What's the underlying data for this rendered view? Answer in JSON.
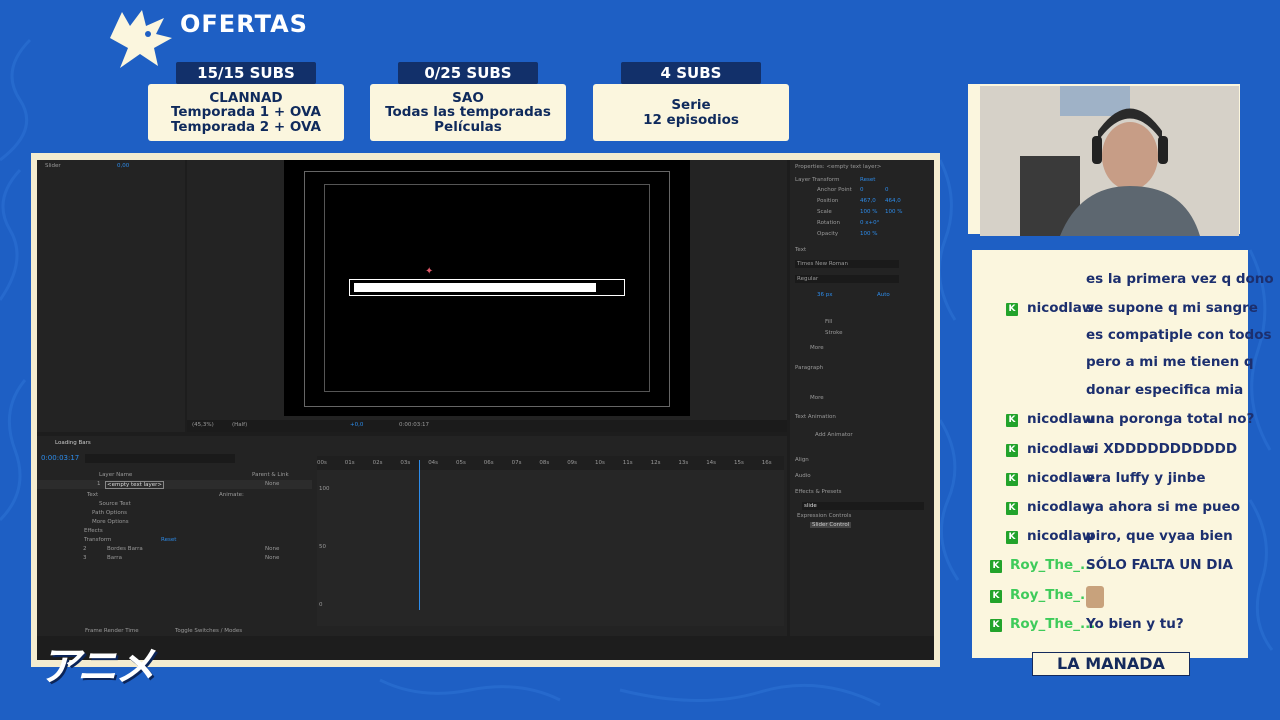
{
  "overlay": {
    "header_title": "OFERTAS",
    "offers": [
      {
        "tag": "15/15 SUBS",
        "lines": [
          "CLANNAD",
          "Temporada 1 + OVA",
          "Temporada 2 + OVA"
        ]
      },
      {
        "tag": "0/25 SUBS",
        "lines": [
          "SAO",
          "Todas las temporadas",
          "Películas"
        ]
      },
      {
        "tag": "4 SUBS",
        "lines": [
          "Serie",
          "12 episodios"
        ]
      }
    ],
    "footer_label": "LA MANADA",
    "anime_logo": "アニメ",
    "colors": {
      "background": "#1e5fc4",
      "card": "#fbf6de",
      "tag": "#12306a",
      "chat_text": "#1c2f6e",
      "badge": "#22a32b"
    }
  },
  "after_effects": {
    "effect_controls": {
      "effect": "Slider",
      "value": "0,00"
    },
    "viewer": {
      "zoom": "(45,3%)",
      "resolution": "(Half)",
      "exposure": "+0,0",
      "timecode": "0:00:03:17"
    },
    "timeline": {
      "comp_name": "Loading Bars",
      "timecode": "0:00:03:17",
      "search_placeholder": "",
      "columns": {
        "layer_name": "Layer Name",
        "parent": "Parent & Link"
      },
      "ruler": [
        "00s",
        "01s",
        "02s",
        "03s",
        "04s",
        "05s",
        "06s",
        "07s",
        "08s",
        "09s",
        "10s",
        "11s",
        "12s",
        "13s",
        "14s",
        "15s",
        "16s"
      ],
      "graph_values": [
        "100",
        "50",
        "0"
      ],
      "layers": [
        {
          "num": "1",
          "name": "<empty text layer>",
          "parent": "None",
          "color": "#d9534f"
        },
        {
          "num": "2",
          "name": "Bordes Barra",
          "parent": "None",
          "color": "#8a6fd1"
        },
        {
          "num": "3",
          "name": "Barra",
          "parent": "None",
          "color": "#8a6fd1"
        }
      ],
      "sub_rows": [
        "Text",
        "Source Text",
        "Path Options",
        "More Options",
        "Effects",
        "Transform"
      ],
      "animate_label": "Animate:",
      "reset_label": "Reset",
      "footer_left": "Frame Render Time",
      "footer_mid": "Toggle Switches / Modes"
    },
    "properties": {
      "title": "Properties: <empty text layer>",
      "layer_transform": "Layer Transform",
      "reset": "Reset",
      "rows": [
        {
          "label": "Anchor Point",
          "v1": "0",
          "v2": "0"
        },
        {
          "label": "Position",
          "v1": "467,0",
          "v2": "464,0"
        },
        {
          "label": "Scale",
          "v1": "100 %",
          "v2": "100 %"
        },
        {
          "label": "Rotation",
          "v1": "0 x+0°",
          "v2": ""
        },
        {
          "label": "Opacity",
          "v1": "100 %",
          "v2": ""
        }
      ],
      "text_section": "Text",
      "font": "Times New Roman",
      "style": "Regular",
      "size": "36 px",
      "leading": "Auto",
      "fill": "Fill",
      "stroke": "Stroke",
      "more": "More",
      "paragraph": "Paragraph",
      "text_animation": "Text Animation",
      "add_animator": "Add Animator",
      "align": "Align",
      "audio": "Audio",
      "effects_presets": "Effects & Presets",
      "search_value": "slide",
      "expression_controls": "Expression Controls",
      "slider_control": "Slider Control"
    }
  },
  "chat": {
    "messages": [
      {
        "user": "",
        "text": "es la primera vez q dono",
        "badge": false,
        "user_style": "blue"
      },
      {
        "user": "nicodlaw",
        "text": "se supone q mi sangre",
        "badge": true,
        "user_style": "blue"
      },
      {
        "user": "",
        "text": "es compatiple con todos",
        "badge": false,
        "user_style": "blue"
      },
      {
        "user": "",
        "text": "pero a mi me tienen q",
        "badge": false,
        "user_style": "blue"
      },
      {
        "user": "",
        "text": "donar especifica mia",
        "badge": false,
        "user_style": "blue"
      },
      {
        "user": "nicodlaw",
        "text": "una poronga total no?",
        "badge": true,
        "user_style": "blue"
      },
      {
        "user": "nicodlaw",
        "text": "si XDDDDDDDDDDD",
        "badge": true,
        "user_style": "blue"
      },
      {
        "user": "nicodlaw",
        "text": "era luffy y jinbe",
        "badge": true,
        "user_style": "blue"
      },
      {
        "user": "nicodlaw",
        "text": "ya ahora si me pueo",
        "badge": true,
        "user_style": "blue"
      },
      {
        "user": "nicodlaw",
        "text": "piro, que vyaa bien",
        "badge": true,
        "user_style": "blue"
      },
      {
        "user": "Roy_The_...",
        "text": "SÓLO FALTA UN DIA",
        "badge": true,
        "user_style": "green"
      },
      {
        "user": "Roy_The_...",
        "text": "",
        "badge": true,
        "user_style": "green",
        "emote": true
      },
      {
        "user": "Roy_The_...",
        "text": "Yo bien y tu?",
        "badge": true,
        "user_style": "green"
      }
    ],
    "badge_letter": "K"
  }
}
